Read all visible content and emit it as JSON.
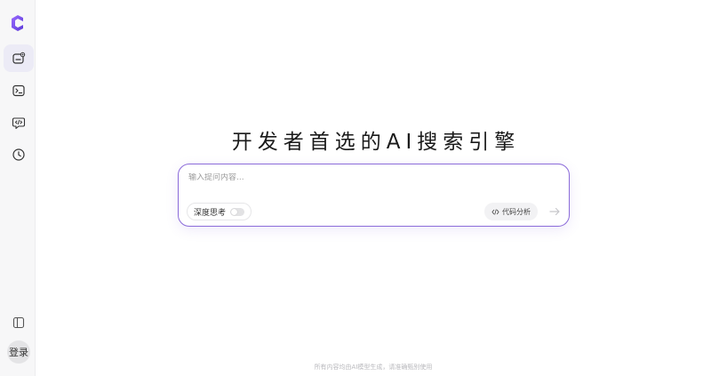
{
  "sidebar": {
    "items": [
      {
        "name": "new-chat",
        "icon": "new-chat-icon",
        "active": true
      },
      {
        "name": "terminal",
        "icon": "terminal-icon",
        "active": false
      },
      {
        "name": "code-chat",
        "icon": "code-chat-icon",
        "active": false
      },
      {
        "name": "history",
        "icon": "clock-icon",
        "active": false
      }
    ],
    "collapse_icon": "sidebar-toggle-icon",
    "login_label": "登录"
  },
  "hero": {
    "title": "开发者首选的AI搜索引擎"
  },
  "composer": {
    "placeholder": "输入提问内容...",
    "deep_think_label": "深度思考",
    "deep_think_enabled": false,
    "code_analysis_label": "代码分析",
    "send_icon": "arrow-right-icon"
  },
  "footer": {
    "note": "所有内容均由AI模型生成，请准确甄别使用"
  },
  "colors": {
    "accent": "#8b6bd9",
    "logo": "#7b4fe0",
    "sidebar_bg": "#f7f7f8"
  }
}
